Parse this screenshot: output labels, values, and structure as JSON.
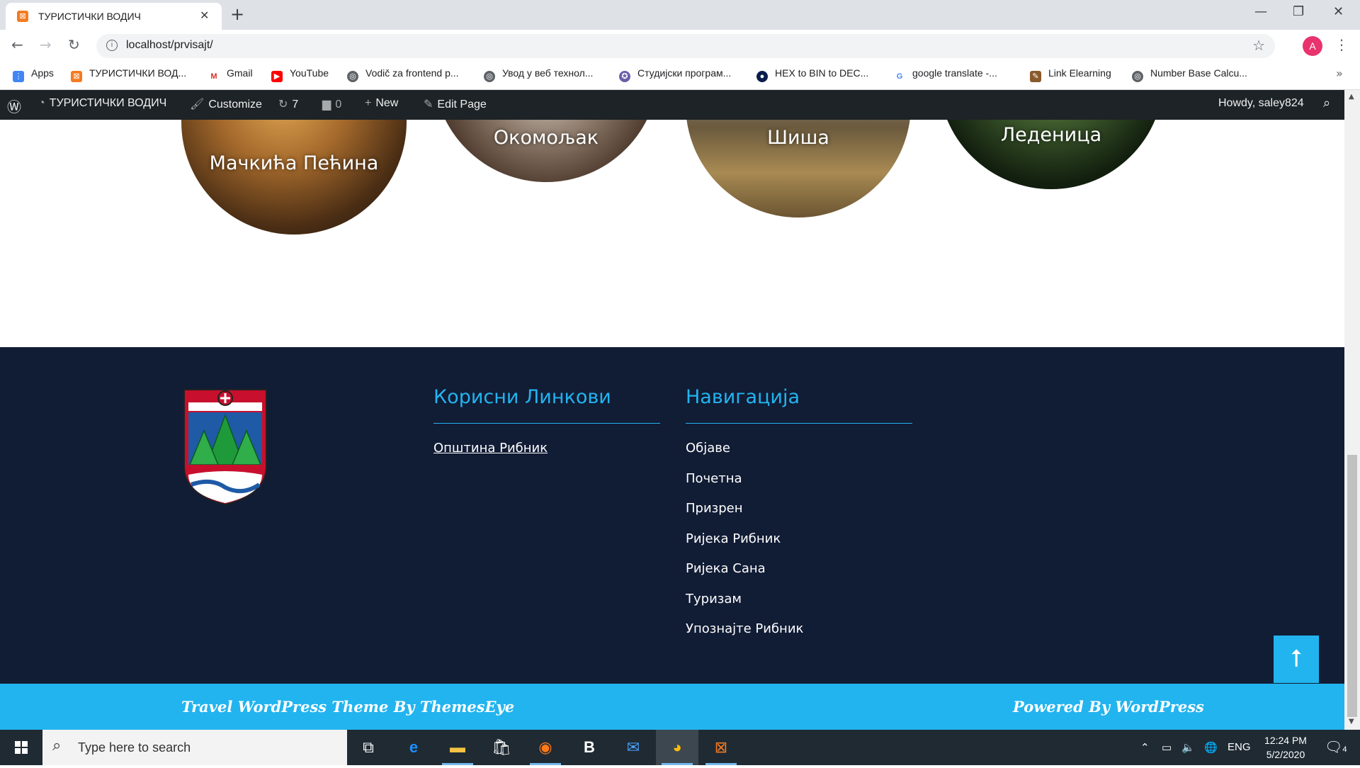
{
  "browser": {
    "tab_title": "ТУРИСТИЧКИ ВОДИЧ",
    "url": "localhost/prvisajt/",
    "profile_initial": "A",
    "bookmarks": [
      {
        "label": "Apps",
        "icon": "apps-grid-icon"
      },
      {
        "label": "ТУРИСТИЧКИ ВОД...",
        "icon": "xampp-icon"
      },
      {
        "label": "Gmail",
        "icon": "gmail-icon"
      },
      {
        "label": "YouTube",
        "icon": "youtube-icon"
      },
      {
        "label": "Vodič za frontend p...",
        "icon": "globe-icon"
      },
      {
        "label": "Увод у веб технол...",
        "icon": "globe-icon"
      },
      {
        "label": "Студијски програм...",
        "icon": "university-seal-icon"
      },
      {
        "label": "HEX to BIN to DEC...",
        "icon": "rapid-tables-icon"
      },
      {
        "label": "google translate -...",
        "icon": "google-icon"
      },
      {
        "label": "Link Elearning",
        "icon": "elearning-icon"
      },
      {
        "label": "Number Base Calcu...",
        "icon": "globe-icon"
      }
    ]
  },
  "wp_admin": {
    "site_name": "ТУРИСТИЧКИ ВОДИЧ",
    "customize": "Customize",
    "updates": "7",
    "comments": "0",
    "new": "New",
    "edit_page": "Edit Page",
    "howdy": "Howdy, saley824"
  },
  "places": [
    {
      "name": "Мачкића Пећина"
    },
    {
      "name": "Окомољак"
    },
    {
      "name": "Шиша"
    },
    {
      "name": "Леденица"
    }
  ],
  "footer": {
    "col1_title": "Корисни Линкови",
    "col1_links": [
      "Општина Рибник"
    ],
    "col2_title": "Навигација",
    "col2_links": [
      "Објаве",
      "Почетна",
      "Призрен",
      "Ријека Рибник",
      "Ријека Сана",
      "Туризам",
      "Упознајте Рибник"
    ],
    "credit_left": "Travel WordPress Theme By ThemesEye",
    "credit_right": "Powered By WordPress",
    "scroll_top_icon": "arrow-up-icon"
  },
  "taskbar": {
    "search_placeholder": "Type here to search",
    "lang": "ENG",
    "time": "12:24 PM",
    "date": "5/2/2020",
    "notifications": "4"
  },
  "colors": {
    "footer_bg": "#111c35",
    "accent": "#22b4ef",
    "wp_bar": "#1d2327"
  }
}
